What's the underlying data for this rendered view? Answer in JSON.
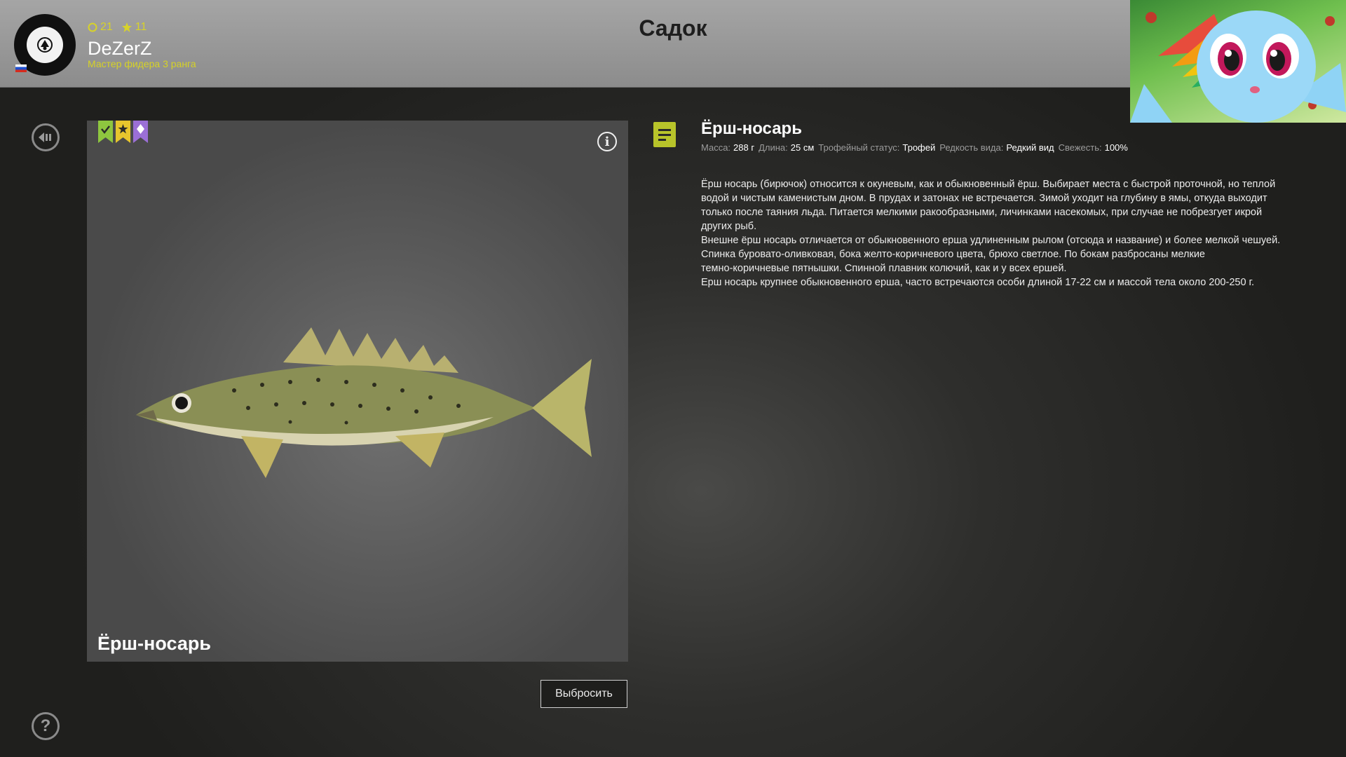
{
  "header": {
    "page_title": "Садок",
    "player": {
      "name": "DeZerZ",
      "rank": "Мастер фидера 3 ранга",
      "coins": "21",
      "stars": "11"
    }
  },
  "fish_card": {
    "caption": "Ёрш-носарь",
    "badges": [
      "check-badge",
      "star-badge",
      "diamond-badge"
    ],
    "badge_colors": [
      "#8ec63f",
      "#e7c52d",
      "#9b6fd6"
    ]
  },
  "actions": {
    "release_label": "Выбросить"
  },
  "details": {
    "title": "Ёрш-носарь",
    "stats": [
      {
        "label": "Масса:",
        "value": "288 г"
      },
      {
        "label": "Длина:",
        "value": "25 см"
      },
      {
        "label": "Трофейный статус:",
        "value": "Трофей"
      },
      {
        "label": "Редкость вида:",
        "value": "Редкий вид"
      },
      {
        "label": "Свежесть:",
        "value": "100%"
      }
    ],
    "description_lines": [
      "Ёрш носарь (бирючок) относится к окуневым, как и обыкновенный ёрш. Выбирает места с быстрой проточной, но теплой",
      "водой и чистым каменистым дном. В прудах и затонах не встречается. Зимой уходит на глубину в ямы, откуда выходит",
      "только после таяния льда. Питается мелкими ракообразными, личинками насекомых, при случае не побрезгует икрой",
      "других рыб.",
      "Внешне ёрш носарь отличается от обыкновенного ерша удлиненным рылом (отсюда и название) и более мелкой чешуей.",
      "Спинка буровато-оливковая, бока желто-коричневого цвета, брюхо светлое. По бокам разбросаны мелкие",
      "темно-коричневые пятнышки. Спинной плавник колючий, как и у всех ершей.",
      "Ерш носарь крупнее обыкновенного ерша, часто встречаются особи длиной 17-22 см и массой тела около 200-250 г."
    ]
  },
  "colors": {
    "accent": "#b8c42a",
    "topbar": "#999999",
    "rank_text": "#d6d226"
  }
}
